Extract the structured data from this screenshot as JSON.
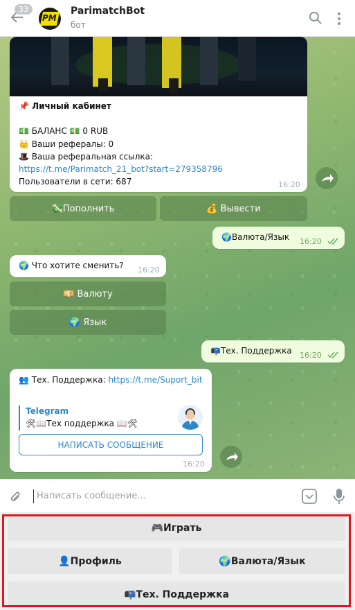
{
  "header": {
    "unread_count": "33",
    "title": "ParimatchBot",
    "subtitle": "бот",
    "logo_text": "PM"
  },
  "messages": {
    "card": {
      "line1": "📌 Личный кабинет",
      "line2": "💵 БАЛАНС 💵 0 RUB",
      "line3": "👑 Ваши рефералы: 0",
      "line4": "🎩 Ваша реферальная ссылка:",
      "link": "https://t.me/Parimatch_21_bot?start=279358796",
      "line6": "Пользователи в сети: 687",
      "time": "16:20",
      "buttons": [
        "💸Пополнить",
        "💰 Вывести"
      ]
    },
    "out1": {
      "text": "🌍Валюта/Язык",
      "time": "16:20"
    },
    "ask": {
      "text": "🌍 Что хотите сменить?",
      "time": "16:20",
      "buttons": [
        "💴 Валюту",
        "🌍 Язык"
      ]
    },
    "out2": {
      "text": "📭Тех. Поддержка",
      "time": "16:20"
    },
    "support": {
      "prefix": "👥 Тех. Поддержка: ",
      "link": "https://t.me/Suport_bit",
      "preview_site": "Telegram",
      "preview_title": "🛠📖Тех поддержка 📖🛠",
      "button": "НАПИСАТЬ СООБЩЕНИЕ",
      "time": "16:20"
    }
  },
  "composer": {
    "placeholder": "Написать сообщение..."
  },
  "reply_keyboard": {
    "play": "🎮Играть",
    "profile": "👤Профиль",
    "currency": "🌍Валюта/Язык",
    "support": "📭Тех. Поддержка"
  },
  "colors": {
    "accent": "#2a87c9",
    "outgoing_bubble": "#effdde",
    "highlight_frame": "#e0181e"
  }
}
